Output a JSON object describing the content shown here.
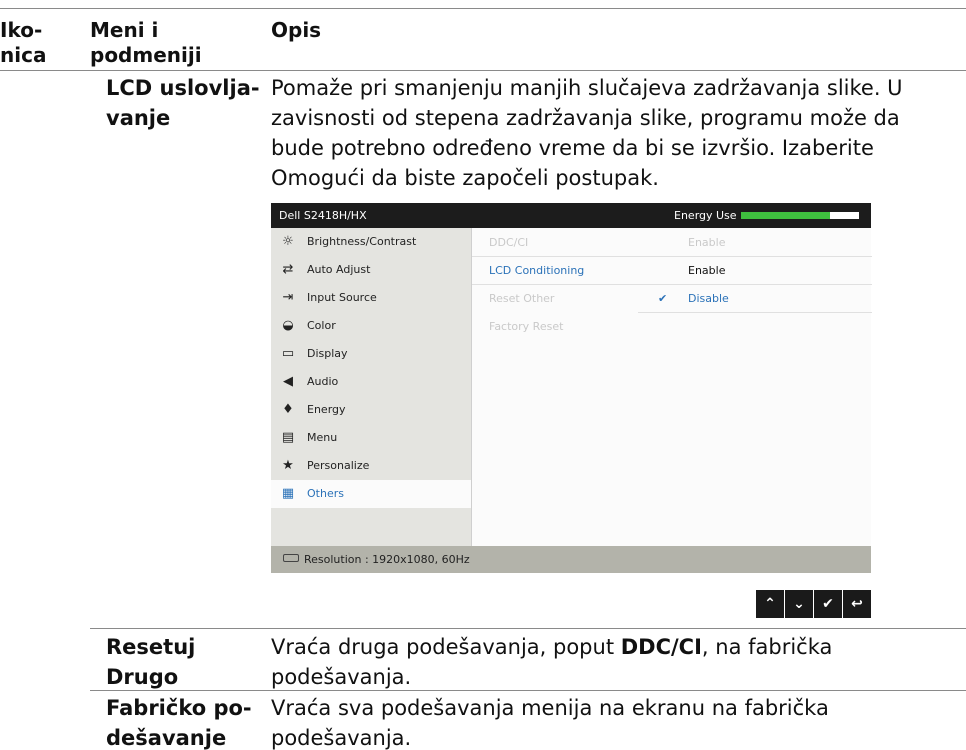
{
  "header": {
    "col1_line1": "Iko-",
    "col1_line2": "nica",
    "col2_line1": "Meni i",
    "col2_line2": "podmeniji",
    "col3": "Opis"
  },
  "lcd": {
    "title_line1": "LCD uslovlja-",
    "title_line2": "vanje",
    "desc_line1": "Pomaže pri smanjenju manjih slučajeva zadržavanja slike. U",
    "desc_line2": "zavisnosti od stepena zadržavanja slike, programu može da",
    "desc_line3": "bude potrebno određeno vreme da bi se izvršio. Izaberite",
    "desc_line4": "Omogući da biste započeli postupak."
  },
  "osd": {
    "model": "Dell S2418H/HX",
    "energy_label": "Energy Use",
    "energy_level": 0.75,
    "menu": [
      {
        "label": "Brightness/Contrast",
        "icon": "brightness-icon",
        "glyph": "☼"
      },
      {
        "label": "Auto Adjust",
        "icon": "auto-adjust-icon",
        "glyph": "⇄"
      },
      {
        "label": "Input Source",
        "icon": "input-source-icon",
        "glyph": "⇥"
      },
      {
        "label": "Color",
        "icon": "color-icon",
        "glyph": "◒"
      },
      {
        "label": "Display",
        "icon": "display-icon",
        "glyph": "▭"
      },
      {
        "label": "Audio",
        "icon": "audio-icon",
        "glyph": "◀"
      },
      {
        "label": "Energy",
        "icon": "energy-icon",
        "glyph": "♦"
      },
      {
        "label": "Menu",
        "icon": "menu-icon",
        "glyph": "▤"
      },
      {
        "label": "Personalize",
        "icon": "star-icon",
        "glyph": "★"
      },
      {
        "label": "Others",
        "icon": "others-icon",
        "glyph": "▦"
      }
    ],
    "selected_menu": "Others",
    "rows": [
      {
        "label": "DDC/CI",
        "value": "Enable"
      },
      {
        "label": "LCD Conditioning",
        "value": "Enable"
      },
      {
        "label": "Reset Other",
        "value": "Disable"
      },
      {
        "label": "Factory Reset",
        "value": ""
      }
    ],
    "resolution": "Resolution : 1920x1080, 60Hz",
    "accent": "#2b72b8"
  },
  "nav_buttons": [
    {
      "name": "up-arrow-icon",
      "glyph": "⌃"
    },
    {
      "name": "down-arrow-icon",
      "glyph": "⌄"
    },
    {
      "name": "check-icon",
      "glyph": "✔"
    },
    {
      "name": "back-icon",
      "glyph": "↩"
    }
  ],
  "reset_other": {
    "title_line1": "Resetuj",
    "title_line2": "Drugo",
    "desc_pre": "Vraća druga podešavanja, poput ",
    "desc_bold": "DDC/CI",
    "desc_post": ", na fabrička",
    "desc_line2": "podešavanja."
  },
  "factory_reset": {
    "title_line1": "Fabričko po-",
    "title_line2": "dešavanje",
    "desc_line1": "Vraća sva podešavanja menija na ekranu na fabrička",
    "desc_line2": "podešavanja."
  }
}
